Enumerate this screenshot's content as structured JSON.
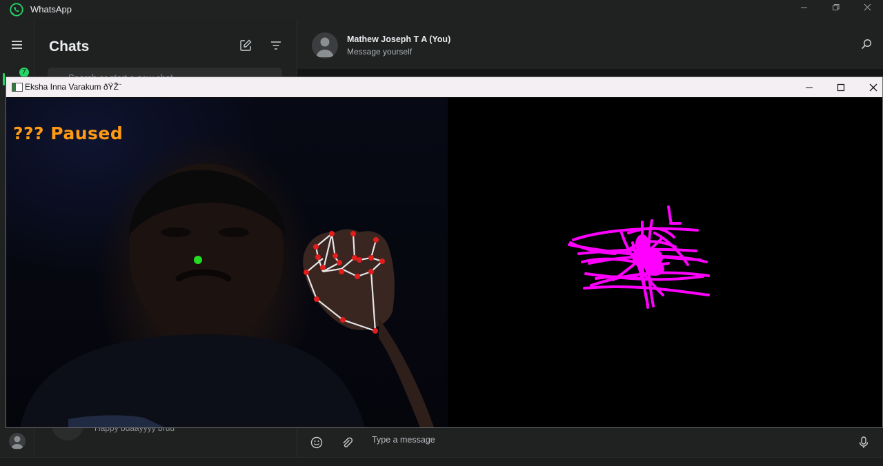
{
  "whatsapp": {
    "app_title": "WhatsApp",
    "rail": {
      "unread_badge": "7"
    },
    "chat_list": {
      "title": "Chats",
      "search_placeholder": "Search or start a new chat",
      "preview_text": "Happy bdaayyyy bruu"
    },
    "chat": {
      "contact_name": "Mathew Joseph T A (You)",
      "contact_subtitle": "Message yourself",
      "message_placeholder": "Type a message"
    }
  },
  "opencv_window": {
    "title": "Eksha Inna Varakum ðŸŽ¨",
    "status_text": "??? Paused",
    "colors": {
      "status": "#ff9a14",
      "stroke": "#ff00ff",
      "landmark": "#e11d1d",
      "cursor": "#22dd22"
    }
  }
}
